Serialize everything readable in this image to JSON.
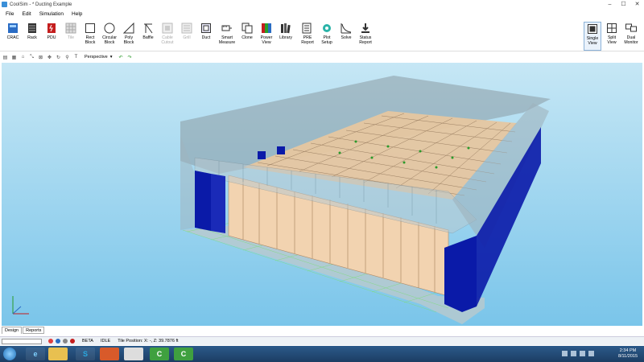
{
  "window": {
    "title": "CoolSim - * Ducting Example",
    "controls": {
      "minimize": "–",
      "maximize": "☐",
      "close": "✕"
    }
  },
  "menu": [
    "File",
    "Edit",
    "Simulation",
    "Help"
  ],
  "toolbar": [
    {
      "label": "CRAC",
      "icon": "crac-icon",
      "enabled": true
    },
    {
      "label": "Rack",
      "icon": "rack-icon",
      "enabled": true
    },
    {
      "label": "PDU",
      "icon": "pdu-icon",
      "enabled": true
    },
    {
      "label": "Tile",
      "icon": "tile-icon",
      "enabled": false
    },
    {
      "label": "Rect\nBlock",
      "icon": "rect-block-icon",
      "enabled": true
    },
    {
      "label": "Circular\nBlock",
      "icon": "circular-block-icon",
      "enabled": true
    },
    {
      "label": "Poly\nBlock",
      "icon": "poly-block-icon",
      "enabled": true
    },
    {
      "label": "Baffle",
      "icon": "baffle-icon",
      "enabled": true
    },
    {
      "label": "Cable\nCutout",
      "icon": "cable-cutout-icon",
      "enabled": false
    },
    {
      "label": "Grill",
      "icon": "grill-icon",
      "enabled": false
    },
    {
      "label": "Duct",
      "icon": "duct-icon",
      "enabled": true
    },
    {
      "label": "Smart\nMeasure",
      "icon": "smart-measure-icon",
      "enabled": true
    },
    {
      "label": "Clone",
      "icon": "clone-icon",
      "enabled": true
    },
    {
      "label": "Power\nView",
      "icon": "power-view-icon",
      "enabled": true
    },
    {
      "label": "Library",
      "icon": "library-icon",
      "enabled": true
    },
    {
      "label": "PRE\nReport",
      "icon": "pre-report-icon",
      "enabled": true
    },
    {
      "label": "Plot\nSetup",
      "icon": "plot-setup-icon",
      "enabled": true
    },
    {
      "label": "Solve",
      "icon": "solve-icon",
      "enabled": true
    },
    {
      "label": "Status\nReport",
      "icon": "status-report-icon",
      "enabled": true
    }
  ],
  "view_buttons": [
    {
      "label": "Single\nView",
      "selected": true
    },
    {
      "label": "Split\nView",
      "selected": false
    },
    {
      "label": "Dual\nMonitor",
      "selected": false
    }
  ],
  "view_tools": {
    "text_tool": "T",
    "projection": "Perspective",
    "dropdown_arrow": "▾"
  },
  "tabs": [
    "Design",
    "Reports"
  ],
  "status": {
    "beta": "BETA",
    "state": "IDLE",
    "tile_position": "Tile Position: X: -, Z: 39.7876 ft"
  },
  "taskbar": {
    "apps": [
      "e",
      "",
      "S",
      "",
      "",
      "C",
      "C"
    ],
    "time": "2:34 PM",
    "date": "8/11/2015"
  },
  "colors": {
    "viewport_top": "#c6e7f5",
    "viewport_bottom": "#7ac5ea",
    "rack_beige": "#f2d3b0",
    "crac_blue": "#0a1aa8",
    "enclosure_gray": "#8a9aa3"
  }
}
